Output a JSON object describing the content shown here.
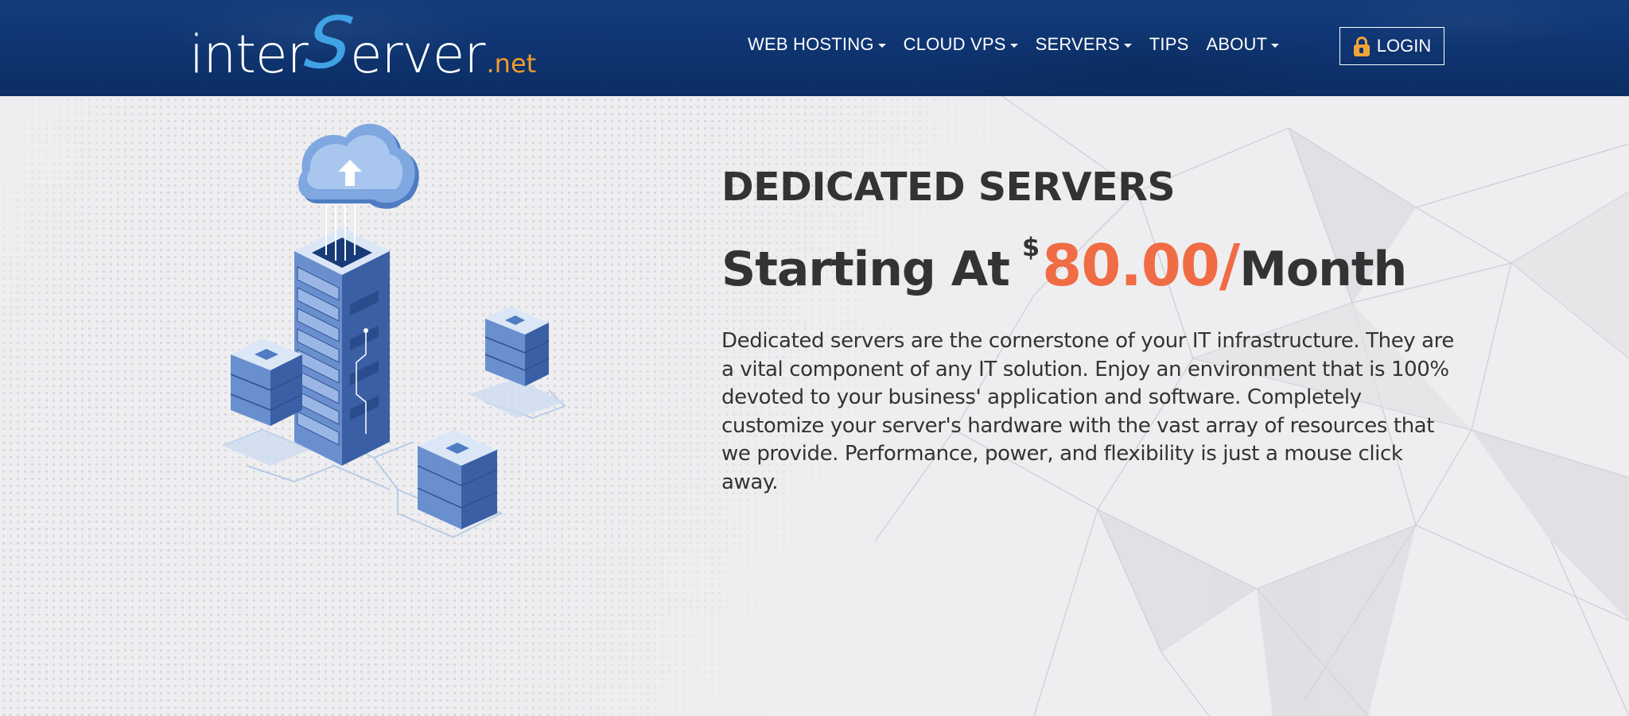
{
  "header": {
    "logo": {
      "inter": "inter",
      "s": "S",
      "erver": "erver",
      "net": ".net"
    },
    "nav": [
      {
        "label": "WEB HOSTING",
        "dropdown": true
      },
      {
        "label": "CLOUD VPS",
        "dropdown": true
      },
      {
        "label": "SERVERS",
        "dropdown": true
      },
      {
        "label": "TIPS",
        "dropdown": false
      },
      {
        "label": "ABOUT",
        "dropdown": true
      }
    ],
    "login": {
      "label": "LOGIN",
      "icon": "lock-icon"
    }
  },
  "hero": {
    "title": "DEDICATED SERVERS",
    "price": {
      "prefix": "Starting At",
      "currency": "$",
      "amount": "80.00/",
      "unit": "Month"
    },
    "description": "Dedicated servers are the cornerstone of your IT infrastructure. They are a vital component of any IT solution. Enjoy an environment that is 100% devoted to your business' application and software. Completely customize your server's hardware with the vast array of resources that we provide. Performance, power, and flexibility is just a mouse click away."
  },
  "colors": {
    "header_bg": "#0e3470",
    "accent_orange": "#ef6c45",
    "logo_blue": "#3fa3e6",
    "logo_orange": "#f39a2b",
    "text_dark": "#333333"
  }
}
